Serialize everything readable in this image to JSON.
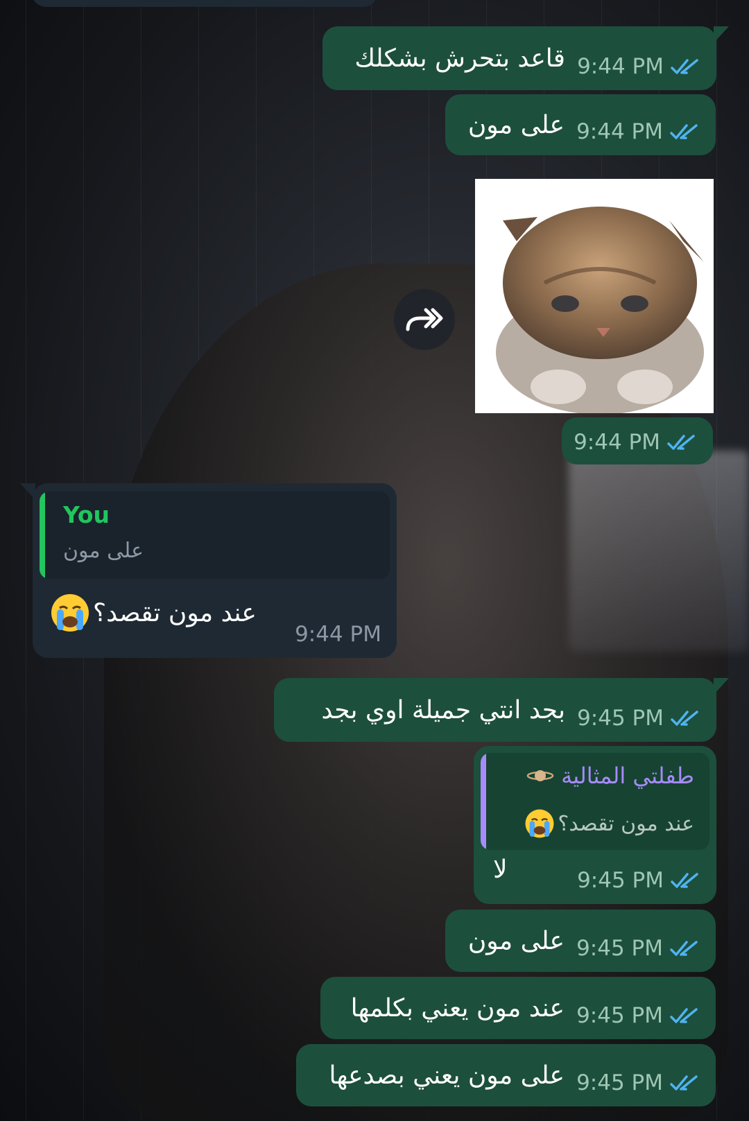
{
  "colors": {
    "outgoing_bubble": "#1d4f3d",
    "incoming_bubble": "#1f2933",
    "read_ticks": "#4fb3f0",
    "reply_you": "#22c55e",
    "reply_other": "#a78bfa"
  },
  "messages": [
    {
      "direction": "out",
      "text": "قاعد بتحرش بشكلك",
      "time": "9:44 PM",
      "status": "read"
    },
    {
      "direction": "out",
      "text": "على مون",
      "time": "9:44 PM",
      "status": "read"
    },
    {
      "direction": "out",
      "type": "sticker",
      "sticker_icon": "sad-kitten-sticker",
      "time": "9:44 PM",
      "status": "read"
    },
    {
      "direction": "in",
      "reply": {
        "name": "You",
        "text": "على مون"
      },
      "text": "عند مون تقصد؟",
      "emoji": "crying-face",
      "time": "9:44 PM"
    },
    {
      "direction": "out",
      "text": "بجد انتي جميلة اوي بجد",
      "time": "9:45 PM",
      "status": "read"
    },
    {
      "direction": "out",
      "reply": {
        "name": "طفلتي المثالية",
        "name_icon": "ringed-planet",
        "text": "عند مون تقصد؟",
        "emoji": "crying-face"
      },
      "text": "لا",
      "time": "9:45 PM",
      "status": "read"
    },
    {
      "direction": "out",
      "text": "على مون",
      "time": "9:45 PM",
      "status": "read"
    },
    {
      "direction": "out",
      "text": "عند مون يعني بكلمها",
      "time": "9:45 PM",
      "status": "read"
    },
    {
      "direction": "out",
      "text": "على مون يعني بصدعها",
      "time": "9:45 PM",
      "status": "read"
    }
  ],
  "actions": {
    "forward_icon": "forward-icon"
  }
}
